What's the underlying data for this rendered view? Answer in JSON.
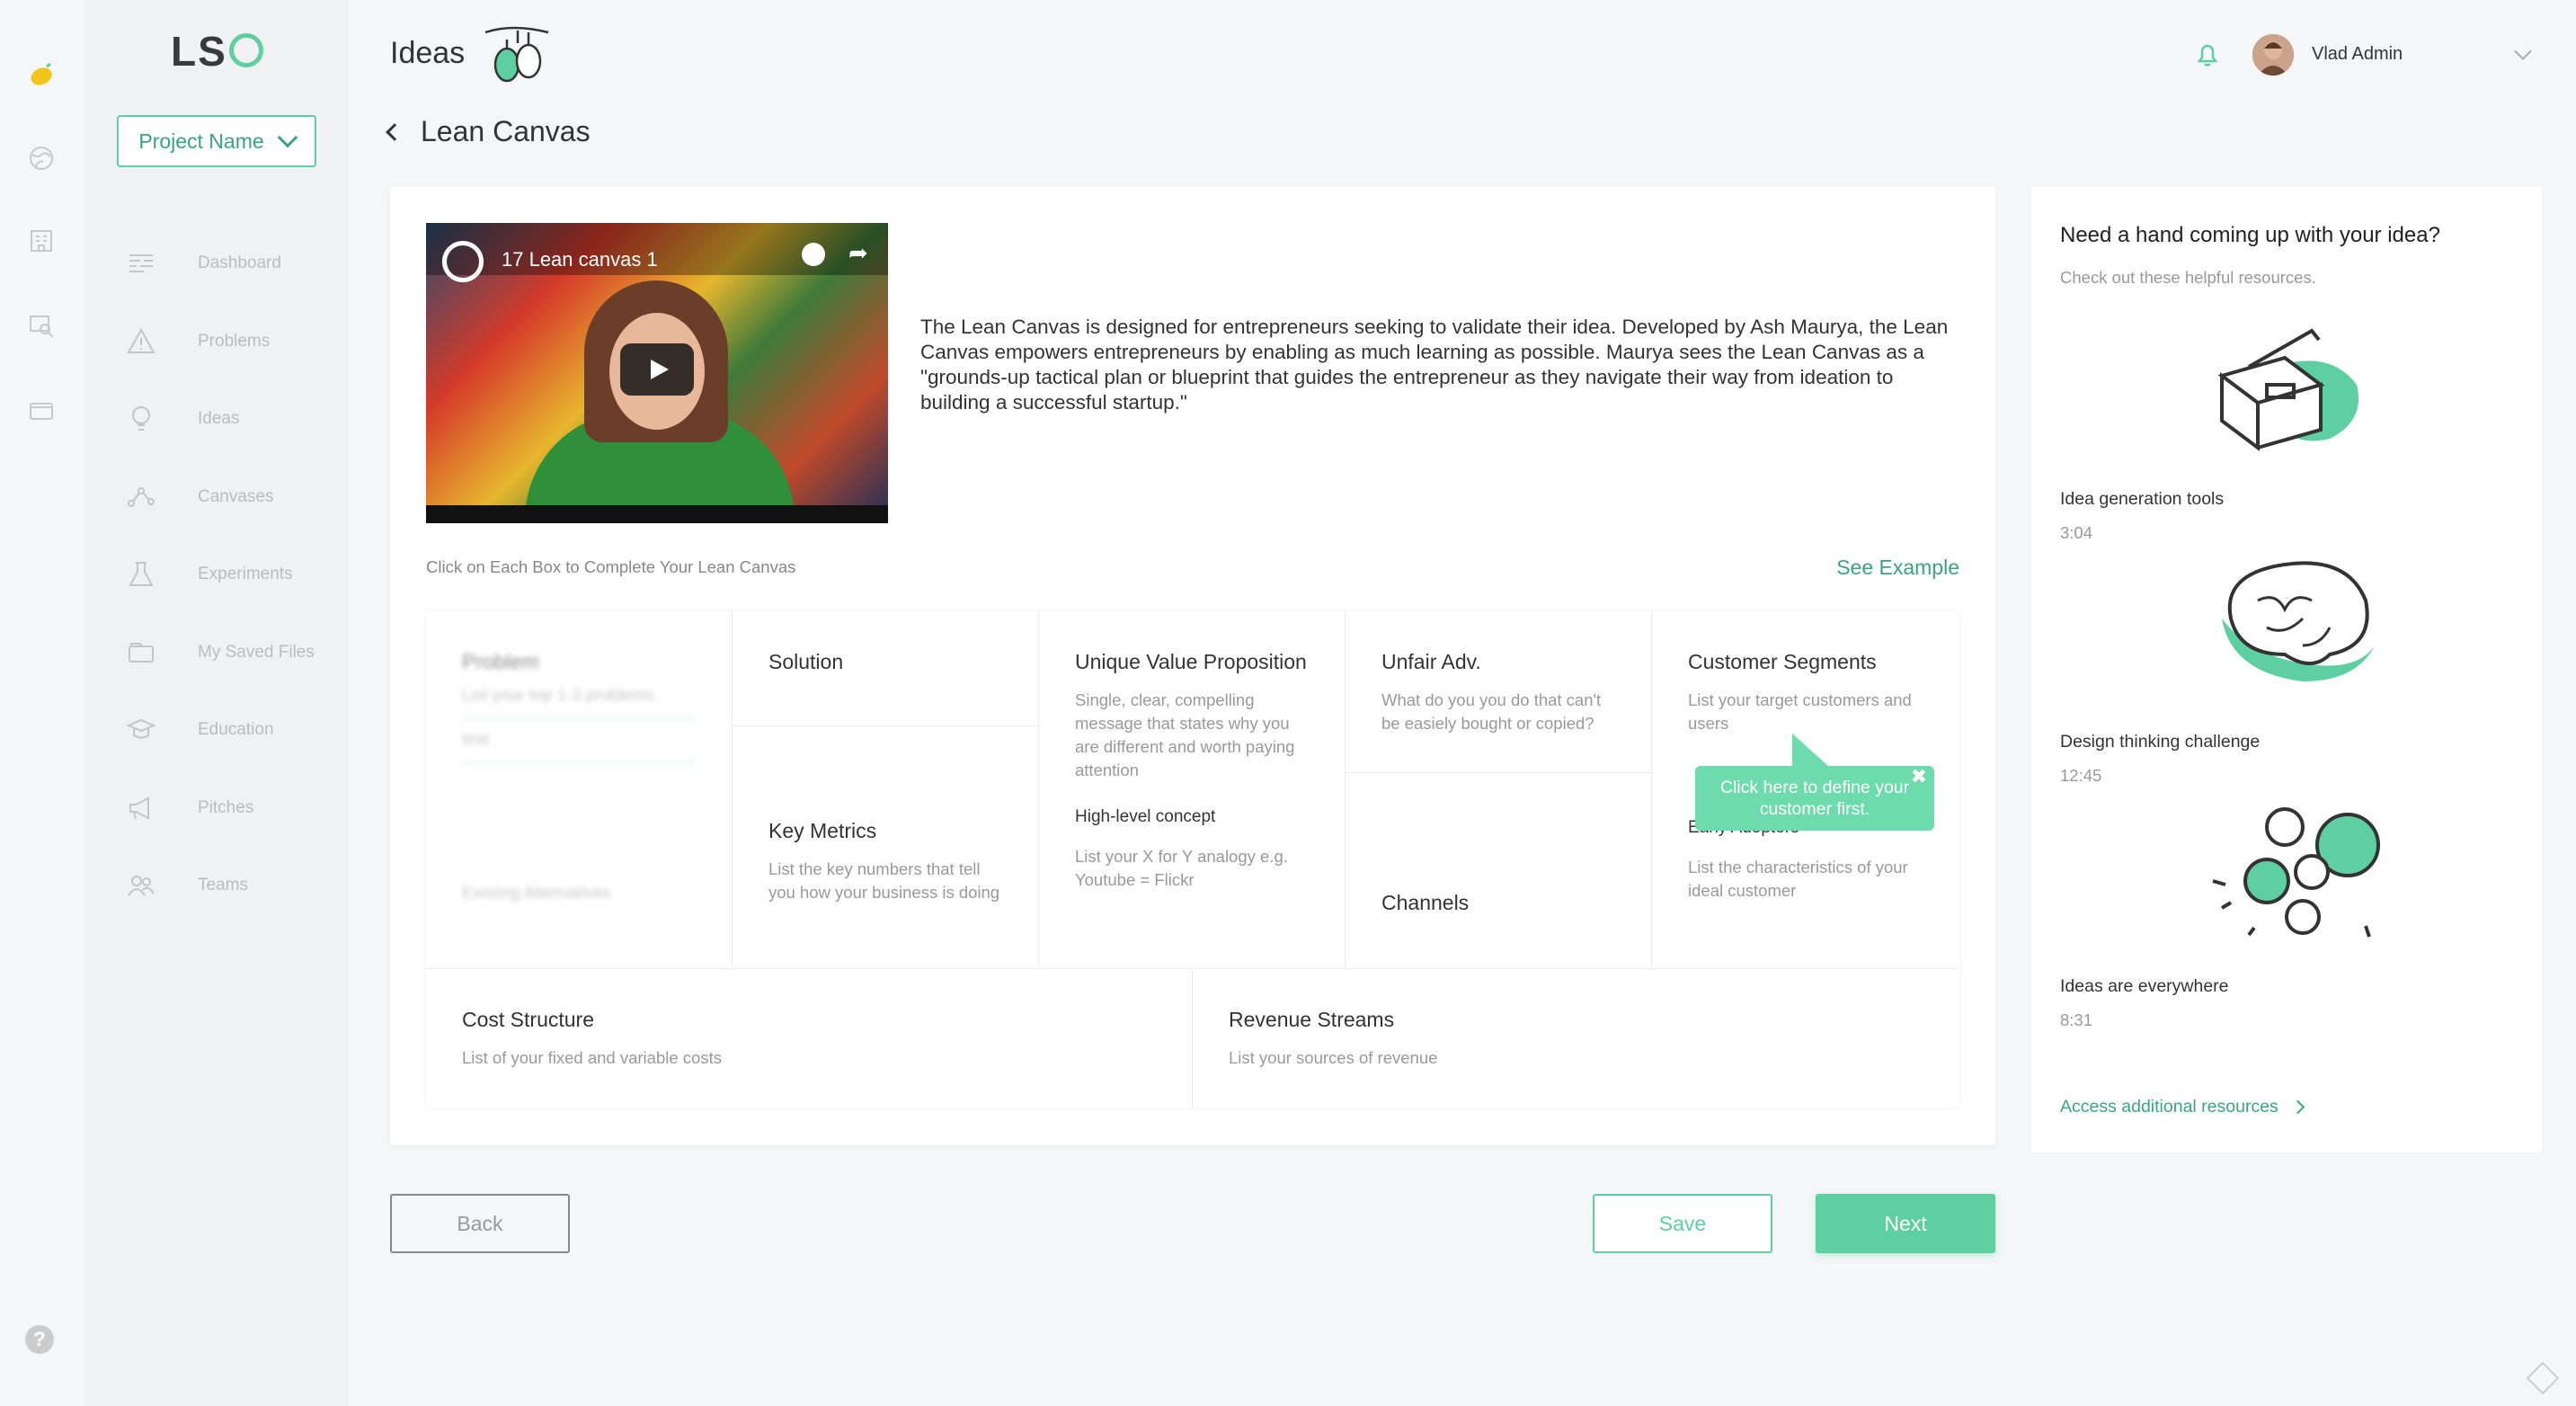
{
  "brand": {
    "logo": "LS"
  },
  "sidebar": {
    "project_select": "Project Name",
    "items": [
      {
        "label": "Dashboard",
        "icon": "dashboard-icon"
      },
      {
        "label": "Problems",
        "icon": "warning-icon"
      },
      {
        "label": "Ideas",
        "icon": "lightbulb-icon"
      },
      {
        "label": "Canvases",
        "icon": "nodes-icon"
      },
      {
        "label": "Experiments",
        "icon": "flask-icon"
      },
      {
        "label": "My Saved Files",
        "icon": "folder-icon"
      },
      {
        "label": "Education",
        "icon": "graduation-cap-icon"
      },
      {
        "label": "Pitches",
        "icon": "megaphone-icon"
      },
      {
        "label": "Teams",
        "icon": "team-icon"
      }
    ]
  },
  "header": {
    "title": "Ideas",
    "subtitle": "Lean Canvas",
    "user_name": "Vlad Admin"
  },
  "main": {
    "video_title": "17 Lean canvas 1",
    "intro": "The Lean Canvas is designed for entrepreneurs seeking to validate their idea. Developed by Ash Maurya, the Lean Canvas empowers entrepreneurs by enabling as much learning as possible. Maurya sees the Lean Canvas as a \"grounds-up tactical plan or blueprint that guides the entrepreneur as they navigate their way from ideation to building a successful startup.\"",
    "hint": "Click on Each Box to Complete Your Lean Canvas",
    "see_example": "See Example",
    "canvas": {
      "problem": {
        "title": "Problem",
        "desc": "List your top 1-3 problems",
        "value": "test",
        "alt": "Existing Alternatives"
      },
      "solution": {
        "title": "Solution"
      },
      "key_metrics": {
        "title": "Key Metrics",
        "desc": "List the key numbers that tell you how your business is doing"
      },
      "uvp": {
        "title": "Unique Value Proposition",
        "desc": "Single, clear, compelling message that states why you are different and worth paying attention",
        "sub_title": "High-level concept",
        "sub_desc": "List your X for Y analogy e.g. Youtube = Flickr"
      },
      "unfair": {
        "title": "Unfair Adv.",
        "desc": "What do you you do that can't be easiely bought or copied?"
      },
      "channels": {
        "title": "Channels"
      },
      "segments": {
        "title": "Customer Segments",
        "desc": "List your target customers and users",
        "sub_title": "Early Adopters",
        "sub_desc": "List the characteristics of your ideal customer"
      },
      "cost": {
        "title": "Cost Structure",
        "desc": "List of your fixed and variable costs"
      },
      "revenue": {
        "title": "Revenue Streams",
        "desc": "List your sources of revenue"
      }
    },
    "tooltip": "Click here to define your customer first."
  },
  "buttons": {
    "back": "Back",
    "save": "Save",
    "next": "Next"
  },
  "resources": {
    "title": "Need a hand coming up with your idea?",
    "subtitle": "Check out these helpful resources.",
    "items": [
      {
        "title": "Idea generation tools",
        "duration": "3:04",
        "icon": "toolbox-illustration-icon"
      },
      {
        "title": "Design thinking challenge",
        "duration": "12:45",
        "icon": "brain-illustration-icon"
      },
      {
        "title": "Ideas are everywhere",
        "duration": "8:31",
        "icon": "lightbulbs-illustration-icon"
      }
    ],
    "more": "Access additional resources"
  },
  "colors": {
    "accent": "#5ecfa0",
    "accent_dark": "#3aa57a"
  }
}
